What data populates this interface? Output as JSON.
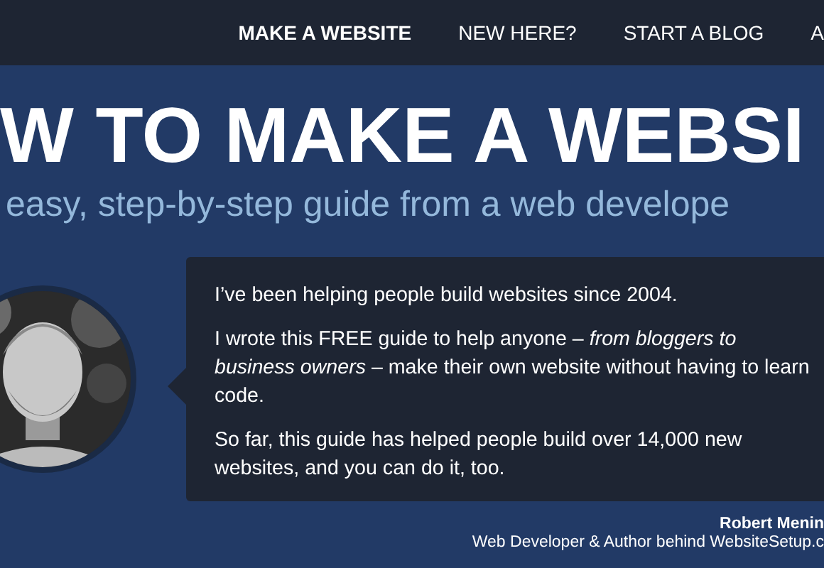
{
  "nav": [
    {
      "label": "MAKE A WEBSITE",
      "selected": true
    },
    {
      "label": "NEW HERE?",
      "selected": false
    },
    {
      "label": "START A BLOG",
      "selected": false
    },
    {
      "label": "A",
      "selected": false
    }
  ],
  "hero": {
    "title": "W TO MAKE A WEBSI",
    "subtitle": "easy, step-by-step guide from a web develope"
  },
  "intro": {
    "paragraphs": [
      "I’ve been helping people build websites since 2004.",
      "I wrote this FREE guide to help anyone – *from bloggers to business owners* – make their own website without having to learn code.",
      "So far, this guide has helped people build over 14,000 new websites, and you can do it, too."
    ],
    "author_name": "Robert Menin",
    "author_role": "Web Developer & Author behind WebsiteSetup.c"
  }
}
